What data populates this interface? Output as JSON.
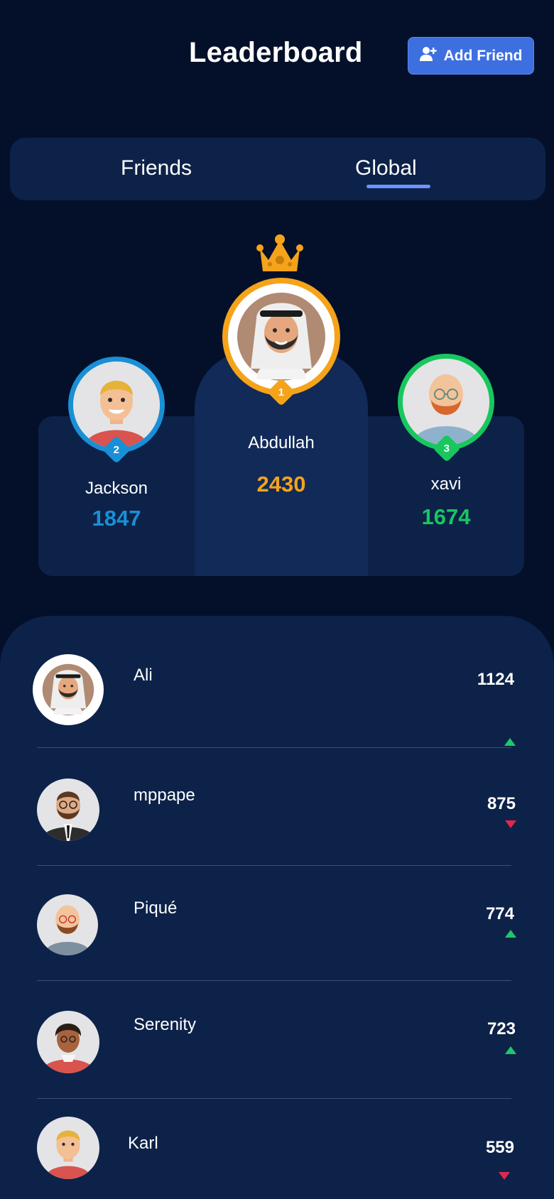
{
  "header": {
    "title": "Leaderboard",
    "add_friend_label": "Add Friend"
  },
  "tabs": [
    {
      "label": "Friends",
      "active": false
    },
    {
      "label": "Global",
      "active": true
    }
  ],
  "podium": [
    {
      "rank": "1",
      "name": "Abdullah",
      "score": "2430",
      "color": "#f5a31a",
      "avatar": "man-keffiyeh-avatar"
    },
    {
      "rank": "2",
      "name": "Jackson",
      "score": "1847",
      "color": "#1a8fd6",
      "avatar": "blond-man-avatar"
    },
    {
      "rank": "3",
      "name": "xavi",
      "score": "1674",
      "color": "#18c75e",
      "avatar": "bald-bearded-man-avatar"
    }
  ],
  "list": [
    {
      "name": "Ali",
      "score": "1124",
      "trend": "up",
      "avatar": "man-keffiyeh-avatar"
    },
    {
      "name": "mppape",
      "score": "875",
      "trend": "down",
      "avatar": "businessman-suit-avatar"
    },
    {
      "name": "Piqué",
      "score": "774",
      "trend": "up",
      "avatar": "bald-bearded-man-avatar"
    },
    {
      "name": "Serenity",
      "score": "723",
      "trend": "up",
      "avatar": "curly-hair-person-avatar"
    },
    {
      "name": "Karl",
      "score": "559",
      "trend": "down",
      "avatar": "blond-man-avatar"
    }
  ],
  "colors": {
    "background": "#041029",
    "panel": "#0d2249",
    "accent": "#3d6fe0",
    "gold": "#f5a31a",
    "silver_blue": "#1a8fd6",
    "bronze_green": "#18c75e",
    "trend_up": "#1fc76a",
    "trend_down": "#e0284f"
  }
}
